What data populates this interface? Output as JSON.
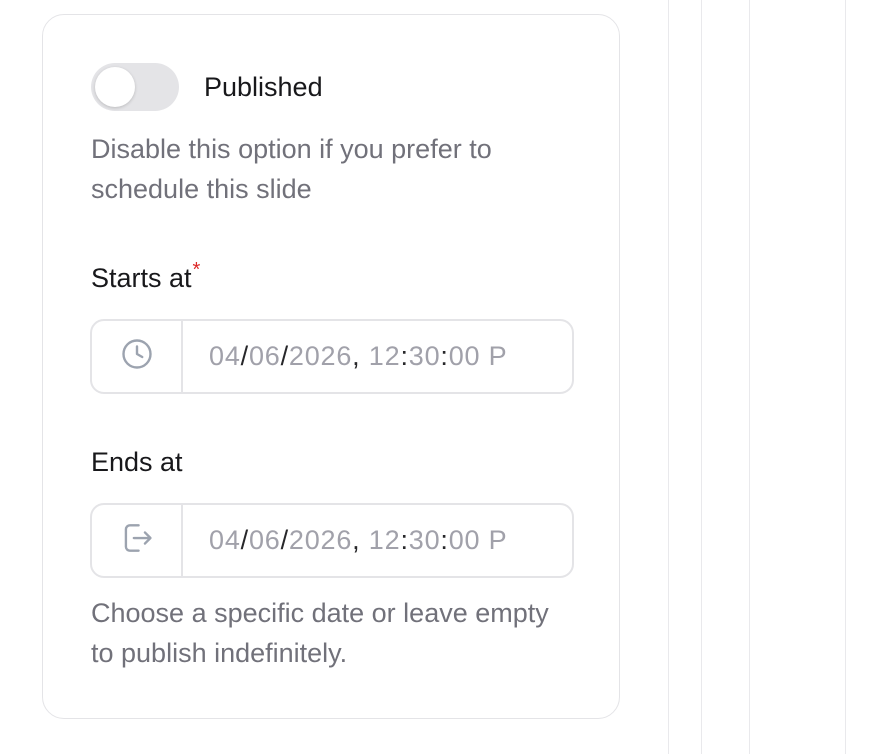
{
  "publish": {
    "label": "Published",
    "enabled": false,
    "help": "Disable this option if you prefer to schedule this slide"
  },
  "starts_at": {
    "label": "Starts at",
    "required_mark": "*",
    "icon": "clock-icon",
    "month": "04",
    "day": "06",
    "year": "2026",
    "hour": "12",
    "minute": "30",
    "second": "00",
    "ampm_partial": "P"
  },
  "ends_at": {
    "label": "Ends at",
    "icon": "exit-icon",
    "month": "04",
    "day": "06",
    "year": "2026",
    "hour": "12",
    "minute": "30",
    "second": "00",
    "ampm_partial": "P",
    "help": "Choose a specific date or leave empty to publish indefinitely."
  },
  "separators": {
    "date": "/",
    "date_time": ",",
    "time": ":"
  },
  "colors": {
    "border": "#e4e4e7",
    "required": "#dc2626",
    "muted_text": "#71717a",
    "placeholder": "#a1a1aa"
  }
}
